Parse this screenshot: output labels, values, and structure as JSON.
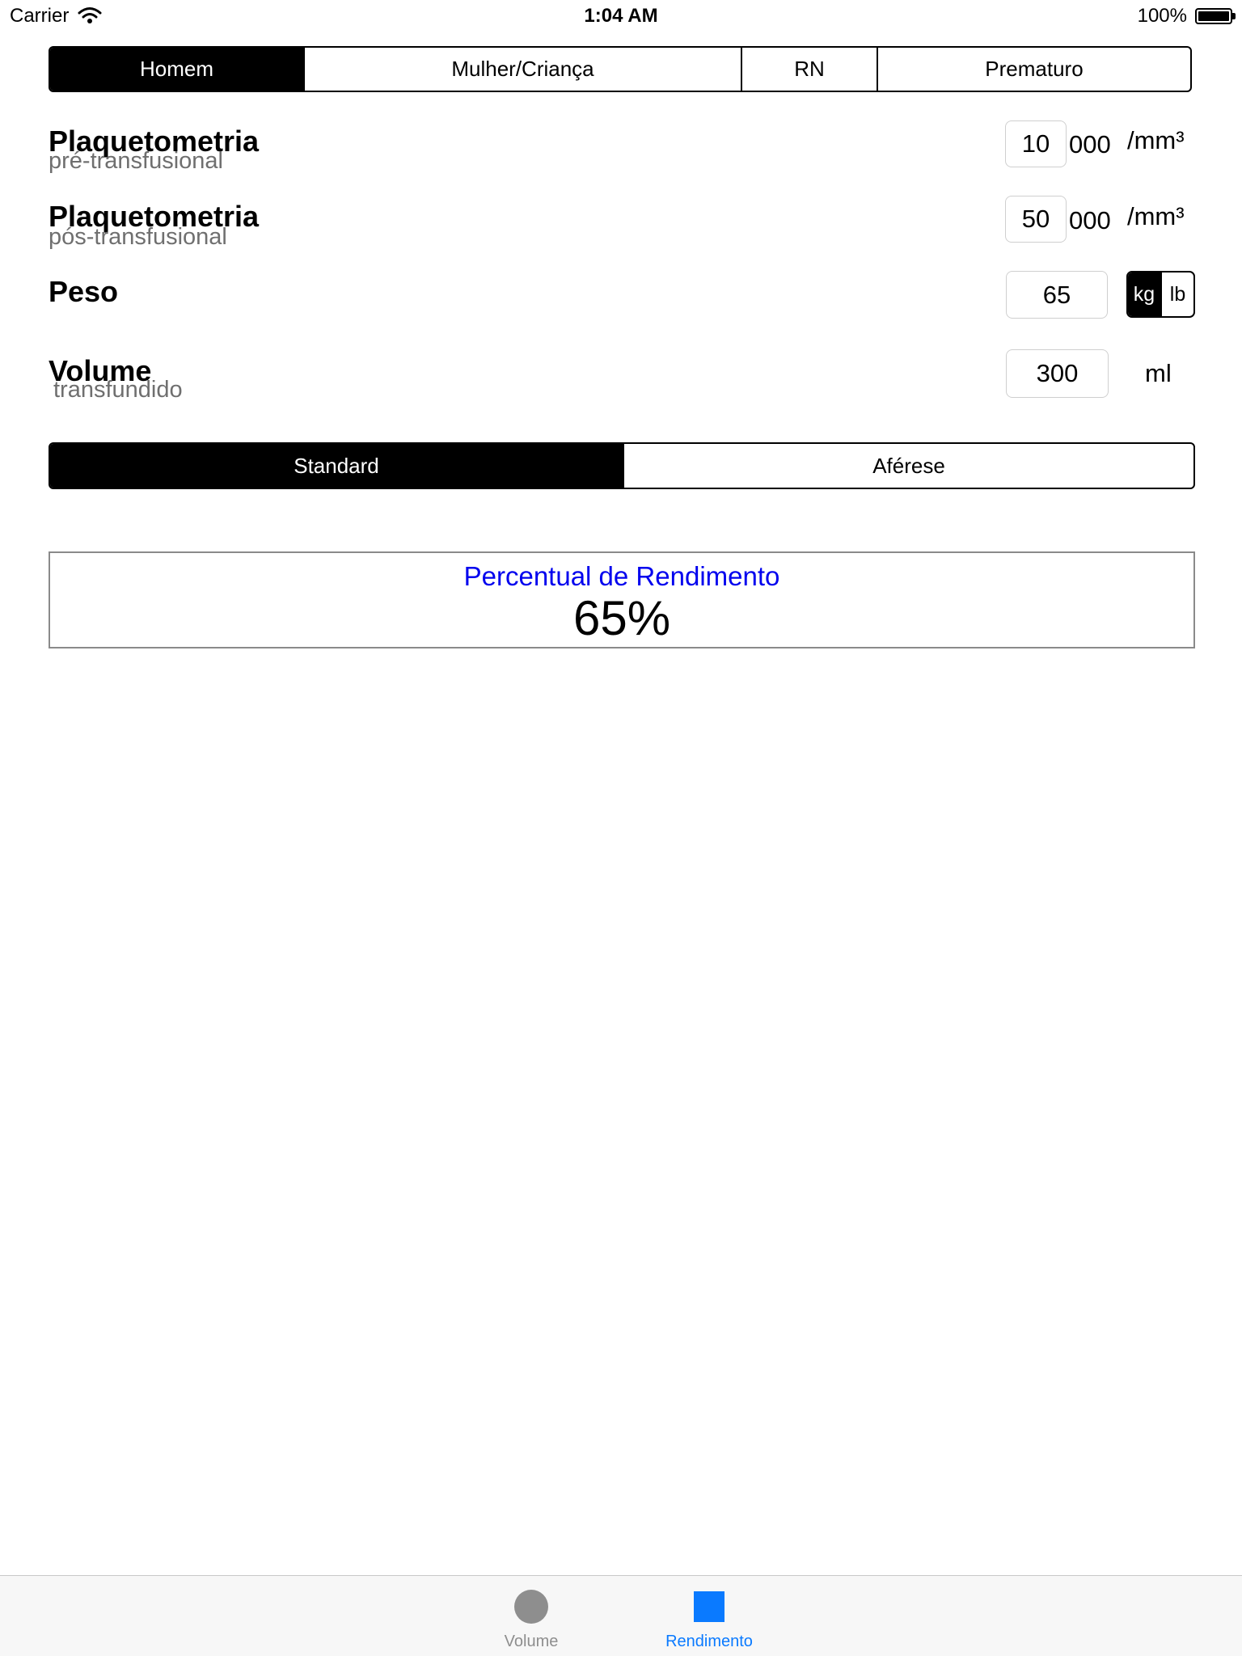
{
  "status_bar": {
    "carrier": "Carrier",
    "time": "1:04 AM",
    "battery": "100%"
  },
  "patient_type": {
    "segments": [
      "Homem",
      "Mulher/Criança",
      "RN",
      "Prematuro"
    ],
    "selected": "Homem"
  },
  "pre_platelets": {
    "title": "Plaquetometria",
    "subtitle": "pré-transfusional",
    "value": "10",
    "suffix": "000",
    "unit": "/mm³"
  },
  "post_platelets": {
    "title": "Plaquetometria",
    "subtitle": "pós-transfusional",
    "value": "50",
    "suffix": "000",
    "unit": "/mm³"
  },
  "weight": {
    "title": "Peso",
    "value": "65",
    "units": [
      "kg",
      "lb"
    ],
    "selected_unit": "kg"
  },
  "volume": {
    "title": "Volume",
    "subtitle": "transfundido",
    "value": "300",
    "unit": "ml"
  },
  "product_type": {
    "segments": [
      "Standard",
      "Aférese"
    ],
    "selected": "Standard"
  },
  "result": {
    "title": "Percentual de Rendimento",
    "value": "65%"
  },
  "tab_bar": {
    "tabs": [
      {
        "label": "Volume",
        "icon": "circle-icon",
        "active": false
      },
      {
        "label": "Rendimento",
        "icon": "square-icon",
        "active": true
      }
    ],
    "active_color": "#0a7aff",
    "inactive_color": "#8e8e8e"
  }
}
